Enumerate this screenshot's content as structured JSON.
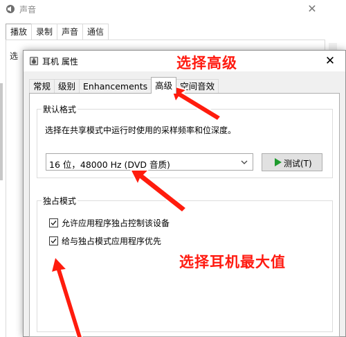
{
  "background_window": {
    "title": "声音",
    "tabs": [
      "播放",
      "录制",
      "声音",
      "通信"
    ],
    "active_tab": 0,
    "panel_text": "选"
  },
  "dialog": {
    "title": "耳机 属性",
    "tabs": [
      {
        "label": "常规"
      },
      {
        "label": "级别"
      },
      {
        "label": "Enhancements"
      },
      {
        "label": "高级",
        "active": true
      },
      {
        "label": "空间音效"
      }
    ],
    "default_format": {
      "legend": "默认格式",
      "description": "选择在共享模式中运行时使用的采样频率和位深度。",
      "selected_format": "16 位，48000 Hz (DVD 音质)",
      "test_button_label": "测试(T)"
    },
    "exclusive_mode": {
      "legend": "独占模式",
      "options": [
        {
          "label": "允许应用程序独占控制该设备",
          "checked": true
        },
        {
          "label": "给与独占模式应用程序优先",
          "checked": true
        }
      ]
    }
  },
  "annotations": {
    "select_advanced": "选择高级",
    "select_max_value": "选择耳机最大值",
    "color": "#ff1a10"
  }
}
